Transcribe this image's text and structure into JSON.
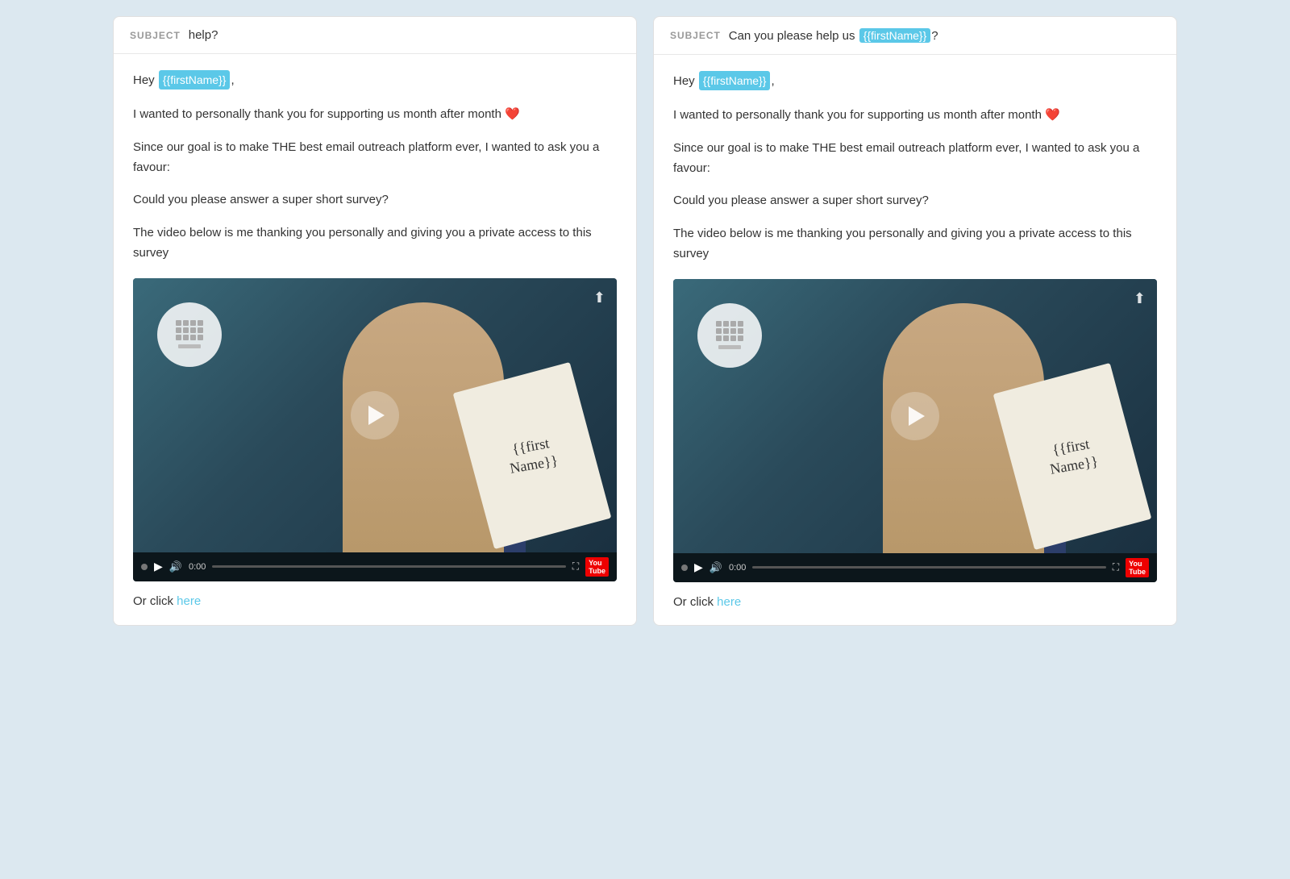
{
  "cards": [
    {
      "id": "card-left",
      "subject_label": "SUBJECT",
      "subject_text_before": "help?",
      "subject_firstname": null,
      "subject_text_after": "",
      "greeting_before": "Hey ",
      "greeting_firstname": "{{firstName}}",
      "greeting_after": ",",
      "para1": "I wanted to personally thank you for supporting us month after month",
      "heart": "❤️",
      "para2": "Since our goal is to make THE best email outreach platform ever, I wanted to ask you a favour:",
      "para3": "Could you please answer a super short survey?",
      "para4": "The video below is me thanking you personally and giving you a private access to this survey",
      "time": "0:00",
      "click_text": "Or click ",
      "click_link": "here",
      "firstname_tag": "{{firstName}}"
    },
    {
      "id": "card-right",
      "subject_label": "SUBJECT",
      "subject_text_before": "Can you please help us ",
      "subject_firstname": "{{firstName}}",
      "subject_text_after": "?",
      "greeting_before": "Hey ",
      "greeting_firstname": "{{firstName}}",
      "greeting_after": ",",
      "para1": "I wanted to personally thank you for supporting us month after month",
      "heart": "❤️",
      "para2": "Since our goal is to make THE best email outreach platform ever, I wanted to ask you a favour:",
      "para3": "Could you please answer a super short survey?",
      "para4": "The video below is me thanking you personally and giving you a private access to this survey",
      "time": "0:00",
      "click_text": "Or click ",
      "click_link": "here",
      "firstname_tag": "{{firstName}}"
    }
  ],
  "icons": {
    "share": "⬆",
    "play": "▶",
    "volume": "🔊",
    "fullscreen": "⛶",
    "youtube_label": "You Tube"
  }
}
